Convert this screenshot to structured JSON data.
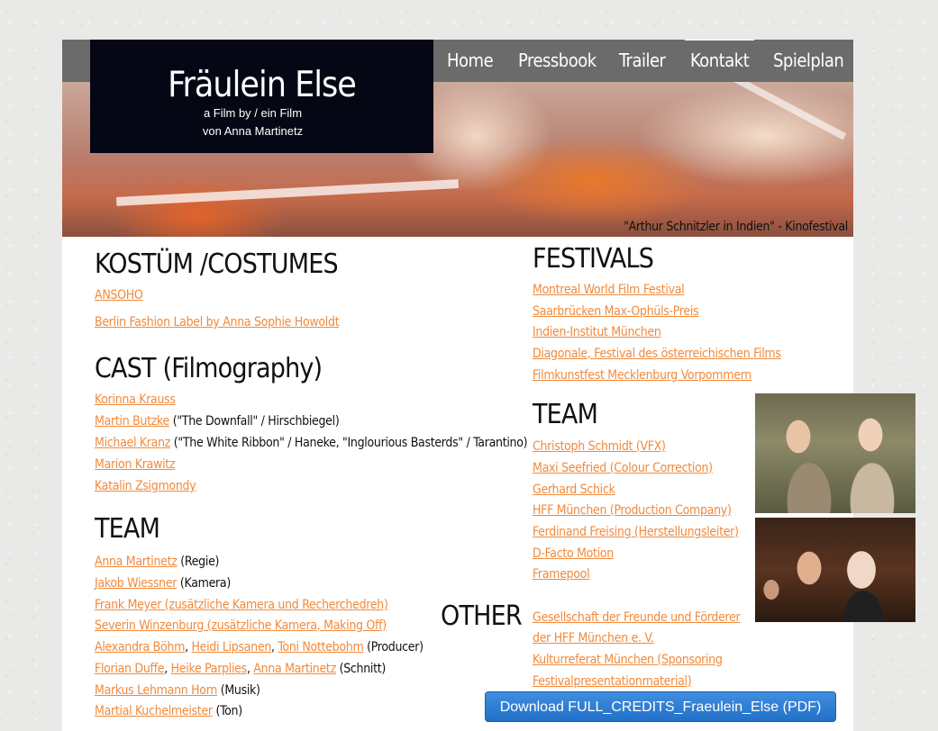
{
  "nav": {
    "items": [
      {
        "label": "Home",
        "active": false
      },
      {
        "label": "Pressbook",
        "active": false
      },
      {
        "label": "Trailer",
        "active": false
      },
      {
        "label": "Kontakt",
        "active": true
      },
      {
        "label": "Spielplan",
        "active": false
      }
    ]
  },
  "header": {
    "title": "Fräulein Else",
    "subtitle_line1": "a Film by / ein Film",
    "subtitle_line2": "von Anna Martinetz",
    "hero_caption": "\"Arthur Schnitzler in Indien\" - Kinofestival"
  },
  "costumes": {
    "heading": "KOSTÜM /COSTUMES",
    "links": [
      "ANSOHO",
      "Berlin Fashion Label by Anna Sophie Howoldt"
    ]
  },
  "cast": {
    "heading": "CAST (Filmography)",
    "rows": [
      {
        "name": "Korinna Krauss",
        "note": ""
      },
      {
        "name": "Martin Butzke",
        "note": " (\"The Downfall\" / Hirschbiegel)"
      },
      {
        "name": "Michael Kranz",
        "note": " (\"The White Ribbon\" / Haneke, \"Inglourious Basterds\" / Tarantino)"
      },
      {
        "name": "Marion Krawitz",
        "note": ""
      },
      {
        "name": "Katalin Zsigmondy",
        "note": ""
      }
    ]
  },
  "team_left": {
    "heading": "TEAM",
    "rows": [
      {
        "links": [
          "Anna Martinetz"
        ],
        "note": " (Regie)"
      },
      {
        "links": [
          "Jakob Wiessner"
        ],
        "note": " (Kamera)"
      },
      {
        "links": [
          "Frank Meyer (zusätzliche Kamera und Recherchedreh)"
        ],
        "note": ""
      },
      {
        "links": [
          "Severin Winzenburg (zusätzliche Kamera, Making Off)"
        ],
        "note": ""
      },
      {
        "links": [
          "Alexandra Böhm",
          "Heidi Lipsanen",
          "Toni Nottebohm"
        ],
        "note": " (Producer)"
      },
      {
        "links": [
          "Florian Duffe",
          "Heike Parplies",
          "Anna Martinetz"
        ],
        "note": " (Schnitt)"
      },
      {
        "links": [
          "Markus Lehmann Horn"
        ],
        "note": " (Musik)"
      },
      {
        "links": [
          "Martial Kuchelmeister"
        ],
        "note": " (Ton)"
      }
    ]
  },
  "festivals": {
    "heading": "FESTIVALS",
    "links": [
      "Montreal World Film Festival",
      "Saarbrücken Max-Ophüls-Preis",
      "Indien-Institut München",
      "Diagonale, Festival des österreichischen Films",
      "Filmkunstfest Mecklenburg Vorpommern"
    ]
  },
  "team_right": {
    "heading": "TEAM",
    "links": [
      "Christoph Schmidt (VFX)",
      "Maxi Seefried (Colour Correction)",
      "Gerhard Schick",
      "HFF München (Production Company)",
      "Ferdinand Freising (Herstellungsleiter)",
      "D-Facto Motion",
      "Framepool"
    ]
  },
  "other": {
    "heading": "OTHER",
    "links": [
      "Gesellschaft der Freunde und Förderer",
      "der HFF München e. V.",
      "Kulturreferat München (Sponsoring",
      "Festivalpresentationmaterial)"
    ]
  },
  "download": {
    "label": "Download FULL_CREDITS_Fraeulein_Else (PDF)"
  },
  "colors": {
    "link": "#f18a3c",
    "nav_bg": "#6b6b6b",
    "logo_bg": "#050814",
    "button": "#2370c8"
  }
}
